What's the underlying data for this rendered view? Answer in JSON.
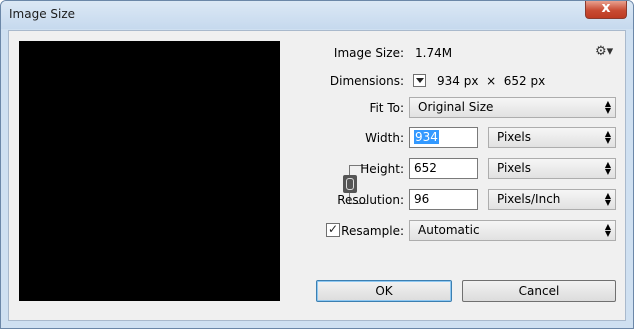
{
  "window": {
    "title": "Image Size",
    "close_label": "x"
  },
  "info": {
    "image_size_label": "Image Size:",
    "image_size_value": "1.74M",
    "dimensions_label": "Dimensions:",
    "dimensions_value": "934 px  ×  652 px"
  },
  "fit_to": {
    "label": "Fit To:",
    "value": "Original Size"
  },
  "width": {
    "label": "Width:",
    "value": "934",
    "unit": "Pixels"
  },
  "height": {
    "label": "Height:",
    "value": "652",
    "unit": "Pixels"
  },
  "resolution": {
    "label": "Resolution:",
    "value": "96",
    "unit": "Pixels/Inch"
  },
  "resample": {
    "label": "Resample:",
    "checked": true,
    "value": "Automatic"
  },
  "buttons": {
    "ok": "OK",
    "cancel": "Cancel"
  },
  "icons": {
    "settings": "gear-icon",
    "link": "chain-link-icon",
    "close": "close-icon"
  },
  "colors": {
    "title_bg": "#c6d9ee",
    "close_bg": "#c84b33",
    "selection": "#3399ff"
  }
}
